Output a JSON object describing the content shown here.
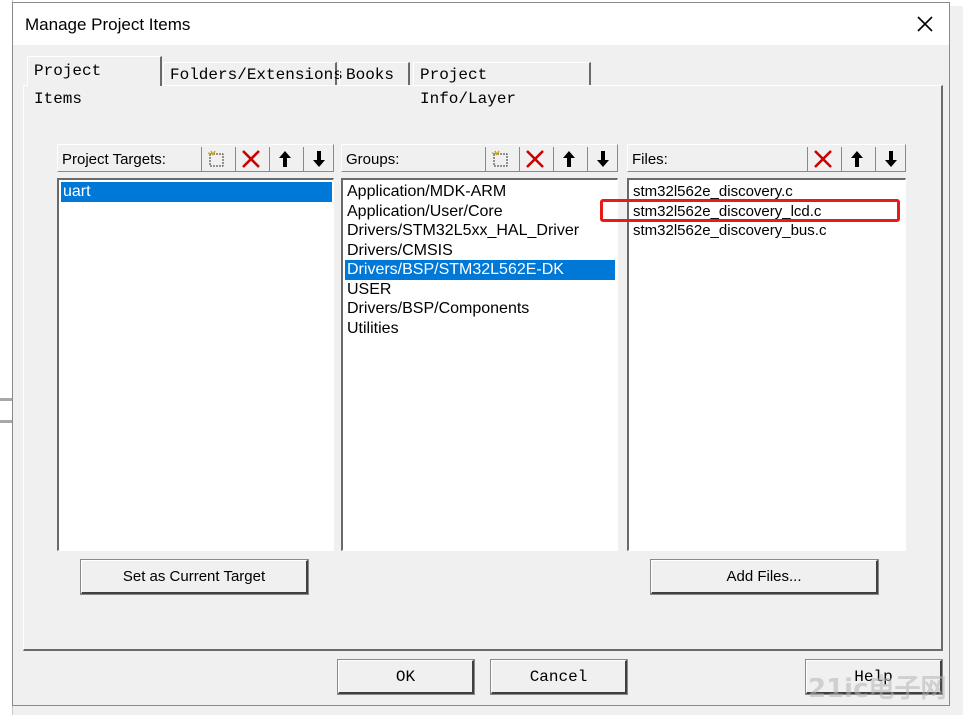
{
  "window": {
    "title": "Manage Project Items"
  },
  "tabs": [
    {
      "label": "Project Items"
    },
    {
      "label": "Folders/Extensions"
    },
    {
      "label": "Books"
    },
    {
      "label": "Project Info/Layer"
    }
  ],
  "targets": {
    "header": "Project Targets:",
    "items": [
      "uart"
    ],
    "selected": "uart",
    "set_current_label": "Set as Current Target"
  },
  "groups": {
    "header": "Groups:",
    "items": [
      "Application/MDK-ARM",
      "Application/User/Core",
      "Drivers/STM32L5xx_HAL_Driver",
      "Drivers/CMSIS",
      "Drivers/BSP/STM32L562E-DK",
      "USER",
      "Drivers/BSP/Components",
      "Utilities"
    ],
    "selected": "Drivers/BSP/STM32L562E-DK"
  },
  "files": {
    "header": "Files:",
    "items": [
      "stm32l562e_discovery.c",
      "stm32l562e_discovery_lcd.c",
      "stm32l562e_discovery_bus.c"
    ],
    "highlighted": "stm32l562e_discovery_lcd.c",
    "add_files_label": "Add Files..."
  },
  "footer": {
    "ok_label": "OK",
    "cancel_label": "Cancel",
    "help_label": "Help"
  },
  "toolbar_icons": [
    "new-item-icon",
    "delete-icon",
    "move-up-icon",
    "move-down-icon"
  ],
  "colors": {
    "selection": "#0078d7",
    "highlight_box": "#e81a1a"
  },
  "watermark": "21ic电子网"
}
